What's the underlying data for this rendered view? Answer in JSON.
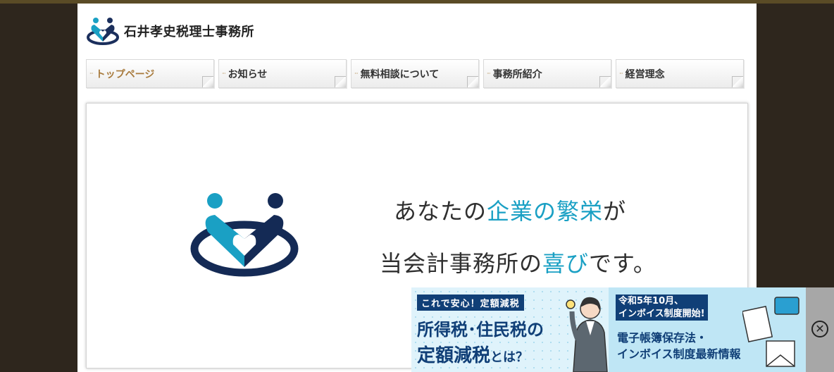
{
  "site": {
    "name": "石井孝史税理士事務所"
  },
  "nav": [
    {
      "label": "トップページ",
      "mark": "···",
      "active": true
    },
    {
      "label": "お知らせ",
      "mark": "···"
    },
    {
      "label": "無料相談について",
      "mark": "···"
    },
    {
      "label": "事務所紹介",
      "mark": "···"
    },
    {
      "label": "経営理念",
      "mark": "···"
    }
  ],
  "hero": {
    "line1_pre": "あなたの",
    "line1_highlight": "企業の繁栄",
    "line1_post": "が",
    "line2_pre": "当会計事務所の",
    "line2_highlight": "喜び",
    "line2_post": "です。"
  },
  "ad": {
    "badge": "これで安心！定額減税",
    "headline1": "所得税･住民税の",
    "headline2_main": "定額減税",
    "headline2_tail": "とは？",
    "date_line1": "令和5年10月、",
    "date_line2": "インボイス制度開始!",
    "info_line1": "電子帳簿保存法・",
    "info_line2": "インボイス制度最新情報",
    "close_symbol": "✕"
  },
  "colors": {
    "background": "#2e261d",
    "accent_blue": "#1aa0c4",
    "navy": "#103f77",
    "nav_active": "#a87a3c"
  },
  "icons": {
    "logo": "heart-people-logo-icon",
    "close": "close-circle-icon"
  }
}
